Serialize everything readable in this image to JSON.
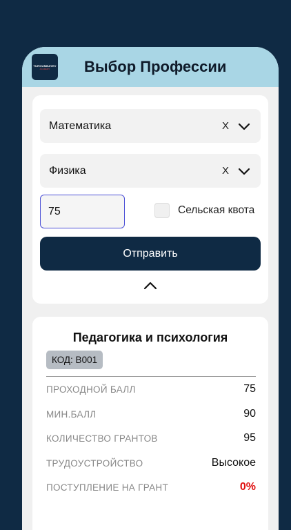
{
  "header": {
    "logo_text": "TURGUMBAYEV",
    "logo_sub": "ACADEMY",
    "title": "Выбор Профессии"
  },
  "form": {
    "subject1": {
      "value": "Математика",
      "clear": "X"
    },
    "subject2": {
      "value": "Физика",
      "clear": "X"
    },
    "score": {
      "value": "75"
    },
    "rural_quota_label": "Сельская квота",
    "submit_label": "Отправить"
  },
  "result": {
    "title": "Педагогика и психология",
    "code": "КОД: B001",
    "rows": [
      {
        "label": "ПРОХОДНОЙ БАЛЛ",
        "value": "75"
      },
      {
        "label": "МИН.БАЛЛ",
        "value": "90"
      },
      {
        "label": "КОЛИЧЕСТВО ГРАНТОВ",
        "value": "95"
      },
      {
        "label": "ТРУДОУСТРОЙСТВО",
        "value": "Высокое"
      },
      {
        "label": "ПОСТУПЛЕНИЕ НА ГРАНТ",
        "value": "0%"
      }
    ]
  },
  "colors": {
    "background": "#0f2a44",
    "header": "#a9d6e5",
    "accent_red": "#e01010",
    "input_focus": "#4b4fd6"
  },
  "icons": [
    "logo",
    "clear-icon",
    "chevron-down-icon",
    "chevron-up-icon",
    "checkbox"
  ]
}
